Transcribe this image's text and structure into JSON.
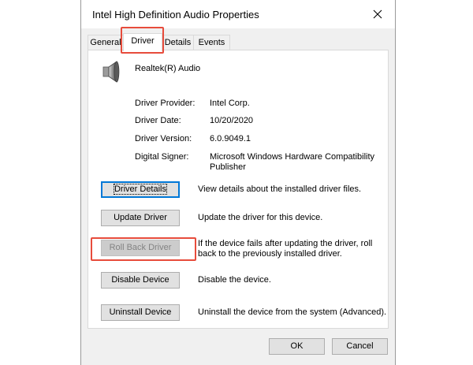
{
  "window": {
    "title": "Intel High Definition Audio Properties"
  },
  "tabs": [
    {
      "label": "General",
      "active": false
    },
    {
      "label": "Driver",
      "active": true
    },
    {
      "label": "Details",
      "active": false
    },
    {
      "label": "Events",
      "active": false
    }
  ],
  "device": {
    "name": "Realtek(R) Audio",
    "icon": "speaker-icon"
  },
  "info": {
    "provider_label": "Driver Provider:",
    "provider_value": "Intel Corp.",
    "date_label": "Driver Date:",
    "date_value": "10/20/2020",
    "version_label": "Driver Version:",
    "version_value": "6.0.9049.1",
    "signer_label": "Digital Signer:",
    "signer_value": "Microsoft Windows Hardware Compatibility Publisher"
  },
  "actions": {
    "details_label": "Driver Details",
    "details_desc": "View details about the installed driver files.",
    "update_label": "Update Driver",
    "update_desc": "Update the driver for this device.",
    "rollback_label": "Roll Back Driver",
    "rollback_desc": "If the device fails after updating the driver, roll back to the previously installed driver.",
    "disable_label": "Disable Device",
    "disable_desc": "Disable the device.",
    "uninstall_label": "Uninstall Device",
    "uninstall_desc": "Uninstall the device from the system (Advanced)."
  },
  "footer": {
    "ok_label": "OK",
    "cancel_label": "Cancel"
  },
  "colors": {
    "highlight": "#e74c3c",
    "focus": "#0078d7"
  }
}
